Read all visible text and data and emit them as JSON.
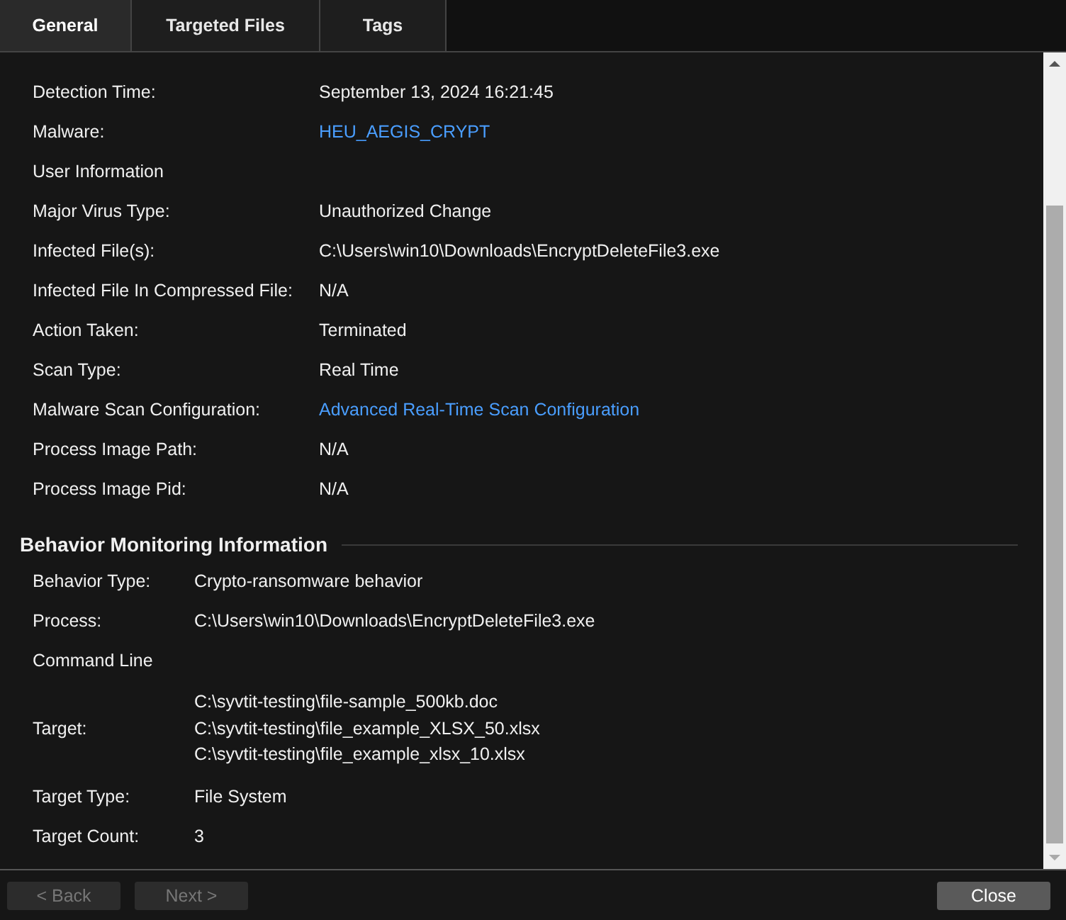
{
  "tabs": [
    {
      "label": "General",
      "selected": true
    },
    {
      "label": "Targeted Files",
      "selected": false
    },
    {
      "label": "Tags",
      "selected": false
    }
  ],
  "threat_information": [
    {
      "label": "Detection Time:",
      "value": "September 13, 2024 16:21:45",
      "kind": "text"
    },
    {
      "label": "Malware:",
      "value": "HEU_AEGIS_CRYPT",
      "kind": "link"
    },
    {
      "label": "User Information",
      "kind": "label"
    },
    {
      "label": "Major Virus Type:",
      "value": "Unauthorized Change",
      "kind": "text"
    },
    {
      "label": "Infected File(s):",
      "value": "C:\\Users\\win10\\Downloads\\EncryptDeleteFile3.exe",
      "kind": "text"
    },
    {
      "label": "Infected File In Compressed File:",
      "value": "N/A",
      "kind": "text"
    },
    {
      "label": "Action Taken:",
      "value": "Terminated",
      "kind": "text"
    },
    {
      "label": "Scan Type:",
      "value": "Real Time",
      "kind": "text"
    },
    {
      "label": "Malware Scan Configuration:",
      "value": "Advanced Real-Time Scan Configuration",
      "kind": "link"
    },
    {
      "label": "Process Image Path:",
      "value": "N/A",
      "kind": "text"
    },
    {
      "label": "Process Image Pid:",
      "value": "N/A",
      "kind": "text"
    }
  ],
  "behavior_monitoring": {
    "title": "Behavior Monitoring Information",
    "rows": [
      {
        "label": "Behavior Type:",
        "values": [
          "Crypto-ransomware behavior"
        ]
      },
      {
        "label": "Process:",
        "values": [
          "C:\\Users\\win10\\Downloads\\EncryptDeleteFile3.exe"
        ]
      },
      {
        "label": "Command Line",
        "values": []
      },
      {
        "label": "Target:",
        "values": [
          "C:\\syvtit-testing\\file-sample_500kb.doc",
          "C:\\syvtit-testing\\file_example_XLSX_50.xlsx",
          "C:\\syvtit-testing\\file_example_xlsx_10.xlsx"
        ]
      },
      {
        "label": "Target Type:",
        "values": [
          "File System"
        ]
      },
      {
        "label": "Target Count:",
        "values": [
          "3"
        ]
      }
    ]
  },
  "buttons": [
    {
      "label": "< Back",
      "disabled": true
    },
    {
      "label": "Next >",
      "disabled": true
    },
    {
      "label": "Close",
      "disabled": false
    }
  ]
}
